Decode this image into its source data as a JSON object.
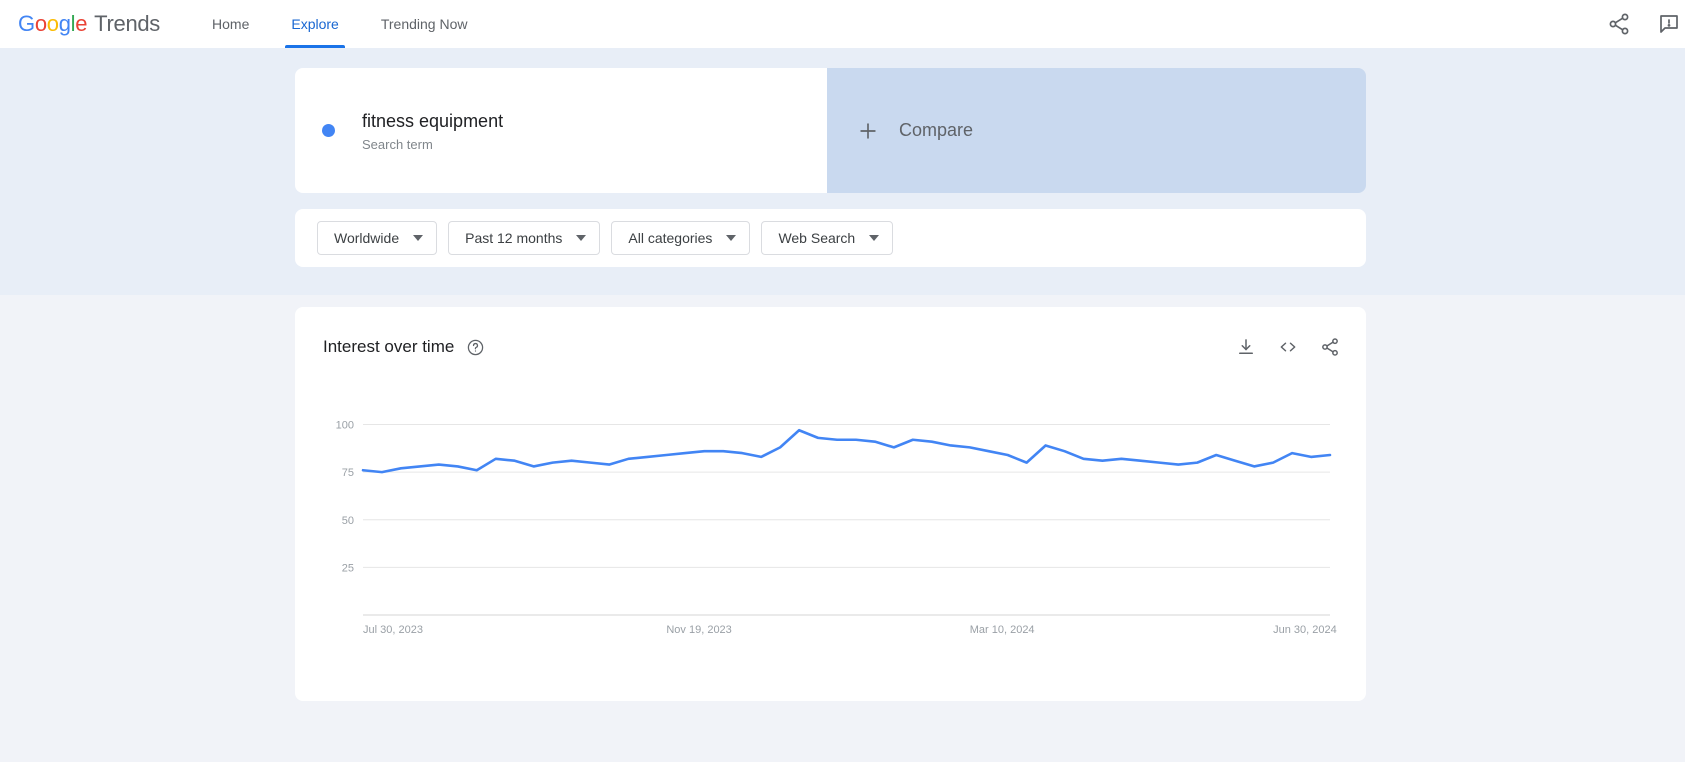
{
  "header": {
    "logo": {
      "google": "Google",
      "product": "Trends"
    },
    "nav": [
      {
        "label": "Home",
        "active": false
      },
      {
        "label": "Explore",
        "active": true
      },
      {
        "label": "Trending Now",
        "active": false
      }
    ],
    "actions": [
      {
        "name": "share-icon",
        "label": "Share"
      },
      {
        "name": "feedback-icon",
        "label": "Send feedback"
      }
    ]
  },
  "query": {
    "term": {
      "title": "fitness equipment",
      "subtitle": "Search term",
      "dot_color": "#4285F4"
    },
    "compare": {
      "label": "Compare",
      "plus_icon": "plus-icon"
    },
    "filters": [
      {
        "name": "location-filter",
        "label": "Worldwide"
      },
      {
        "name": "time-range-filter",
        "label": "Past 12 months"
      },
      {
        "name": "category-filter",
        "label": "All categories"
      },
      {
        "name": "search-type-filter",
        "label": "Web Search"
      }
    ]
  },
  "chart_panel": {
    "title": "Interest over time",
    "help_icon": "help-icon",
    "actions": [
      {
        "name": "download-csv-icon",
        "label": "Download"
      },
      {
        "name": "embed-code-icon",
        "label": "Embed"
      },
      {
        "name": "share-chart-icon",
        "label": "Share"
      }
    ]
  },
  "chart_data": {
    "type": "line",
    "title": "Interest over time",
    "xlabel": "",
    "ylabel": "",
    "ylim": [
      0,
      105
    ],
    "yticks": [
      25,
      50,
      75,
      100
    ],
    "grid": true,
    "legend": false,
    "line_color": "#4285F4",
    "xtick_labels": [
      "Jul 30, 2023",
      "Nov 19, 2023",
      "Mar 10, 2024",
      "Jun 30, 2024"
    ],
    "xtick_positions": [
      0,
      16,
      32,
      48
    ],
    "x": [
      "Jul 30, 2023",
      "Aug 6, 2023",
      "Aug 13, 2023",
      "Aug 20, 2023",
      "Aug 27, 2023",
      "Sep 3, 2023",
      "Sep 10, 2023",
      "Sep 17, 2023",
      "Sep 24, 2023",
      "Oct 1, 2023",
      "Oct 8, 2023",
      "Oct 15, 2023",
      "Oct 22, 2023",
      "Oct 29, 2023",
      "Nov 5, 2023",
      "Nov 12, 2023",
      "Nov 19, 2023",
      "Nov 26, 2023",
      "Dec 3, 2023",
      "Dec 10, 2023",
      "Dec 17, 2023",
      "Dec 24, 2023",
      "Dec 31, 2023",
      "Jan 7, 2024",
      "Jan 14, 2024",
      "Jan 21, 2024",
      "Jan 28, 2024",
      "Feb 4, 2024",
      "Feb 11, 2024",
      "Feb 18, 2024",
      "Feb 25, 2024",
      "Mar 3, 2024",
      "Mar 10, 2024",
      "Mar 17, 2024",
      "Mar 24, 2024",
      "Mar 31, 2024",
      "Apr 7, 2024",
      "Apr 14, 2024",
      "Apr 21, 2024",
      "Apr 28, 2024",
      "May 5, 2024",
      "May 12, 2024",
      "May 19, 2024",
      "May 26, 2024",
      "Jun 2, 2024",
      "Jun 9, 2024",
      "Jun 16, 2024",
      "Jun 23, 2024",
      "Jun 30, 2024",
      "Jul 7, 2024",
      "Jul 14, 2024",
      "Jul 21, 2024"
    ],
    "values": [
      76,
      75,
      77,
      78,
      79,
      78,
      76,
      82,
      81,
      78,
      80,
      81,
      80,
      79,
      82,
      83,
      84,
      85,
      86,
      86,
      85,
      83,
      88,
      97,
      93,
      92,
      92,
      91,
      88,
      92,
      91,
      89,
      88,
      86,
      84,
      80,
      89,
      86,
      82,
      81,
      82,
      81,
      80,
      79,
      80,
      84,
      81,
      78,
      80,
      85,
      83,
      84
    ]
  }
}
